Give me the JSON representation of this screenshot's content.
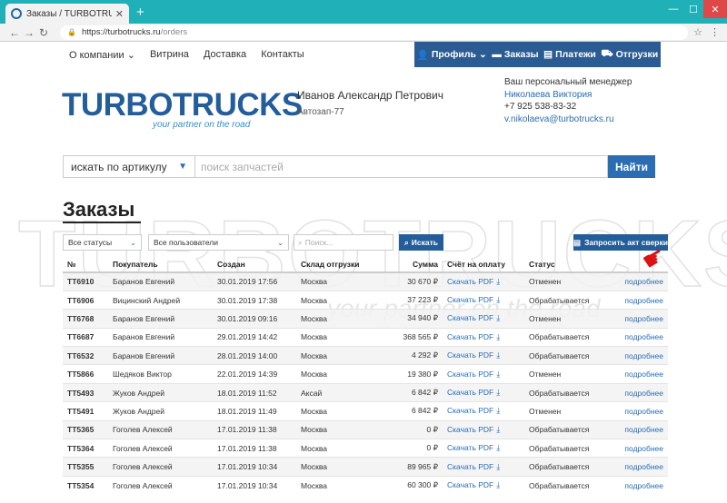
{
  "browser": {
    "tab_title": "Заказы / TURBOTRUCKS — зап…",
    "url_host": "https://turbotrucks.ru",
    "url_path": "/orders"
  },
  "topnav": {
    "left": [
      "О компании",
      "Витрина",
      "Доставка",
      "Контакты"
    ],
    "right": [
      "Профиль",
      "Заказы",
      "Платежи",
      "Отгрузки"
    ]
  },
  "logo": {
    "word": "TURBOTRUCKS",
    "tagline": "your partner on the road"
  },
  "user": {
    "name": "Иванов Александр Петрович",
    "org": "Автозап-77"
  },
  "manager": {
    "label": "Ваш персональный менеджер",
    "name": "Николаева Виктория",
    "phone": "+7 925 538-83-32",
    "email": "v.nikolaeva@turbotrucks.ru"
  },
  "search": {
    "mode": "искать по артикулу",
    "placeholder": "поиск запчастей",
    "button": "Найти"
  },
  "page_title": "Заказы",
  "filters": {
    "status": "Все статусы",
    "users": "Все пользователи",
    "search_placeholder": "Поиск...",
    "search_button": "Искать",
    "akt_button": "Запросить акт сверки"
  },
  "table": {
    "headers": [
      "№",
      "Покупатель",
      "Создан",
      "Склад отгрузки",
      "Сумма",
      "Счёт на оплату",
      "Статус",
      ""
    ],
    "pdf_label": "Скачать PDF",
    "more_label": "подробнее",
    "rows": [
      {
        "num": "TT6910",
        "buyer": "Баранов Евгений",
        "created": "30.01.2019 17:56",
        "warehouse": "Москва",
        "sum": "30 670 ₽",
        "status": "Отменен"
      },
      {
        "num": "TT6906",
        "buyer": "Вицинский Андрей",
        "created": "30.01.2019 17:38",
        "warehouse": "Москва",
        "sum": "37 223 ₽",
        "status": "Обрабатывается"
      },
      {
        "num": "TT6768",
        "buyer": "Баранов Евгений",
        "created": "30.01.2019 09:16",
        "warehouse": "Москва",
        "sum": "34 940 ₽",
        "status": "Отменен"
      },
      {
        "num": "TT6687",
        "buyer": "Баранов Евгений",
        "created": "29.01.2019 14:42",
        "warehouse": "Москва",
        "sum": "368 565 ₽",
        "status": "Обрабатывается"
      },
      {
        "num": "TT6532",
        "buyer": "Баранов Евгений",
        "created": "28.01.2019 14:00",
        "warehouse": "Москва",
        "sum": "4 292 ₽",
        "status": "Обрабатывается"
      },
      {
        "num": "TT5866",
        "buyer": "Шедяков Виктор",
        "created": "22.01.2019 14:39",
        "warehouse": "Москва",
        "sum": "19 380 ₽",
        "status": "Отменен"
      },
      {
        "num": "TT5493",
        "buyer": "Жуков Андрей",
        "created": "18.01.2019 11:52",
        "warehouse": "Аксай",
        "sum": "6 842 ₽",
        "status": "Обрабатывается"
      },
      {
        "num": "TT5491",
        "buyer": "Жуков Андрей",
        "created": "18.01.2019 11:49",
        "warehouse": "Москва",
        "sum": "6 842 ₽",
        "status": "Отменен"
      },
      {
        "num": "TT5365",
        "buyer": "Гоголев Алексей",
        "created": "17.01.2019 11:38",
        "warehouse": "Москва",
        "sum": "0 ₽",
        "status": "Обрабатывается"
      },
      {
        "num": "TT5364",
        "buyer": "Гоголев Алексей",
        "created": "17.01.2019 11:38",
        "warehouse": "Москва",
        "sum": "0 ₽",
        "status": "Обрабатывается"
      },
      {
        "num": "TT5355",
        "buyer": "Гоголев Алексей",
        "created": "17.01.2019 10:34",
        "warehouse": "Москва",
        "sum": "89 965 ₽",
        "status": "Обрабатывается"
      },
      {
        "num": "TT5354",
        "buyer": "Гоголев Алексей",
        "created": "17.01.2019 10:34",
        "warehouse": "Москва",
        "sum": "60 300 ₽",
        "status": "Обрабатывается"
      }
    ]
  }
}
